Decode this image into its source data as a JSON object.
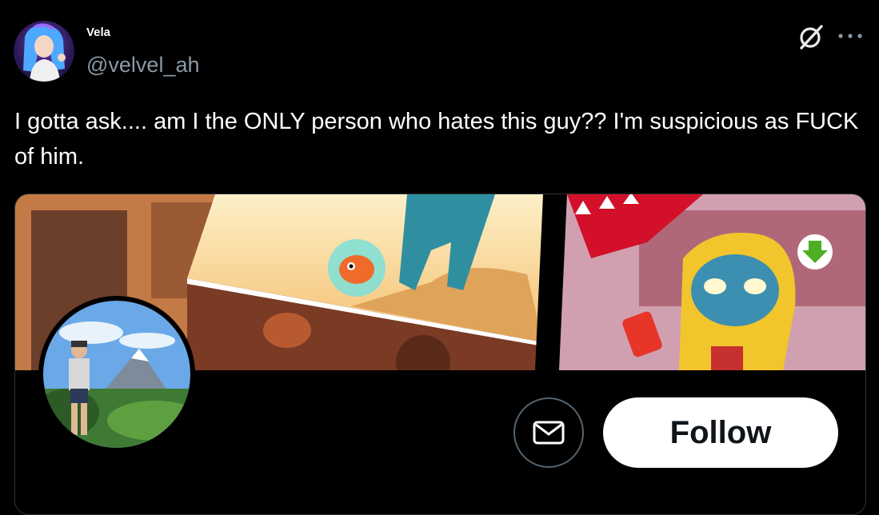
{
  "author": {
    "display_name": "Vela",
    "handle": "@velvel_ah",
    "avatar_icon": "user-avatar"
  },
  "actions": {
    "grok_icon": "grok-icon",
    "more_icon": "more-options-icon"
  },
  "tweet": {
    "text": "I gotta ask.... am I the ONLY person who hates this guy?? I'm suspicious as FUCK of him."
  },
  "card": {
    "banner_icon": "comic-banner-image",
    "download_badge_icon": "download-arrow-icon",
    "profile_photo_icon": "profile-photo",
    "message_icon": "envelope-icon",
    "follow_label": "Follow"
  },
  "colors": {
    "background": "#000000",
    "text": "#ffffff",
    "muted": "#8b98a5",
    "follow_bg": "#ffffff",
    "follow_text": "#0f1419"
  }
}
